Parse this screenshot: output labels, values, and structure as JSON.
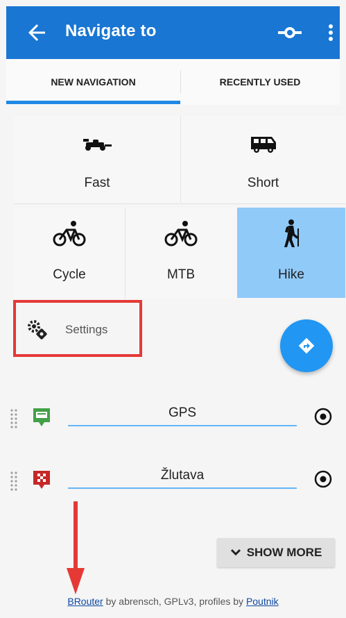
{
  "appbar": {
    "title": "Navigate to",
    "back_icon": "arrow-back-icon",
    "route_icon": "route-icon",
    "menu_icon": "more-vert-icon",
    "color": "#1976d2"
  },
  "tabs": [
    {
      "label": "NEW NAVIGATION",
      "selected": true
    },
    {
      "label": "RECENTLY USED",
      "selected": false
    }
  ],
  "routing_types": [
    {
      "label": "Fast",
      "icon": "racing-car-icon",
      "selected": false
    },
    {
      "label": "Short",
      "icon": "van-icon",
      "selected": false
    },
    {
      "label": "Cycle",
      "icon": "bicycle-icon",
      "selected": false
    },
    {
      "label": "MTB",
      "icon": "mountain-bike-icon",
      "selected": false
    },
    {
      "label": "Hike",
      "icon": "hiker-icon",
      "selected": true
    }
  ],
  "settings": {
    "label": "Settings",
    "icon": "gear-icon"
  },
  "waypoints": [
    {
      "value": "GPS",
      "pin_color": "#43a047",
      "pin_icon": "gps-pin-icon"
    },
    {
      "value": "Žlutava",
      "pin_color": "#c62828",
      "pin_icon": "finish-flag-pin-icon"
    }
  ],
  "show_more": {
    "label": "SHOW MORE",
    "icon": "chevron-down-icon"
  },
  "footer": {
    "link1": "BRouter",
    "middle": " by abrensch, GPLv3, profiles by ",
    "link2": "Poutnik"
  },
  "colors": {
    "accent": "#2196f3",
    "selected_cell": "#90caf9",
    "highlight": "#e53935"
  }
}
